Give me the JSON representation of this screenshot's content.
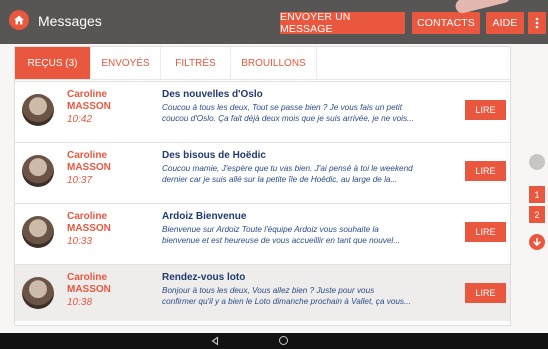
{
  "header": {
    "title": "Messages",
    "send_label": "ENVOYER UN MESSAGE",
    "contacts_label": "CONTACTS",
    "help_label": "AIDE",
    "home_icon": "home-icon",
    "more_icon": "more-vertical-icon"
  },
  "tabs": [
    {
      "label": "REÇUS (3)",
      "active": true
    },
    {
      "label": "ENVOYÉS",
      "active": false
    },
    {
      "label": "FILTRÉS",
      "active": false
    },
    {
      "label": "BROUILLONS",
      "active": false
    }
  ],
  "messages": [
    {
      "first_name": "Caroline",
      "last_name": "MASSON",
      "time": "10:42",
      "subject": "Des nouvelles d'Oslo",
      "preview_1": "Coucou à tous les deux,    Tout se passe bien ?    Je vous fais un petit",
      "preview_2": "coucou d'Oslo. Ça fait déjà deux mois que je suis  arrivée, je ne vois...",
      "action": "LIRE"
    },
    {
      "first_name": "Caroline",
      "last_name": "MASSON",
      "time": "10:37",
      "subject": "Des bisous de Hoëdic",
      "preview_1": "Coucou mamie,    J'espère que tu vas bien. J'ai pensé à toi le weekend",
      "preview_2": "dernier car je suis  allé sur la petite île de Hoëdic, au large de la...",
      "action": "LIRE"
    },
    {
      "first_name": "Caroline",
      "last_name": "MASSON",
      "time": "10:33",
      "subject": "Ardoiz Bienvenue",
      "preview_1": "Bienvenue sur Ardoiz   Toute l'équipe Ardoiz vous souhaite la",
      "preview_2": "bienvenue et est heureuse de vous  accueillir en tant que nouvel...",
      "action": "LIRE"
    },
    {
      "first_name": "Caroline",
      "last_name": "MASSON",
      "time": "10:38",
      "subject": "Rendez-vous loto",
      "preview_1": "Bonjour à tous les deux,    Vous allez bien ?    Juste pour vous",
      "preview_2": "confirmer qu'il y a bien le Loto dimanche prochain à  Vallet, ça vous...",
      "action": "LIRE"
    }
  ],
  "pager": {
    "pages": [
      "1",
      "2"
    ],
    "up_icon": "scroll-up-icon",
    "down_icon": "arrow-down-icon"
  },
  "colors": {
    "accent": "#e9573f",
    "topbar": "#585654",
    "subject": "#1f3a6d",
    "preview": "#2b4c8a"
  }
}
